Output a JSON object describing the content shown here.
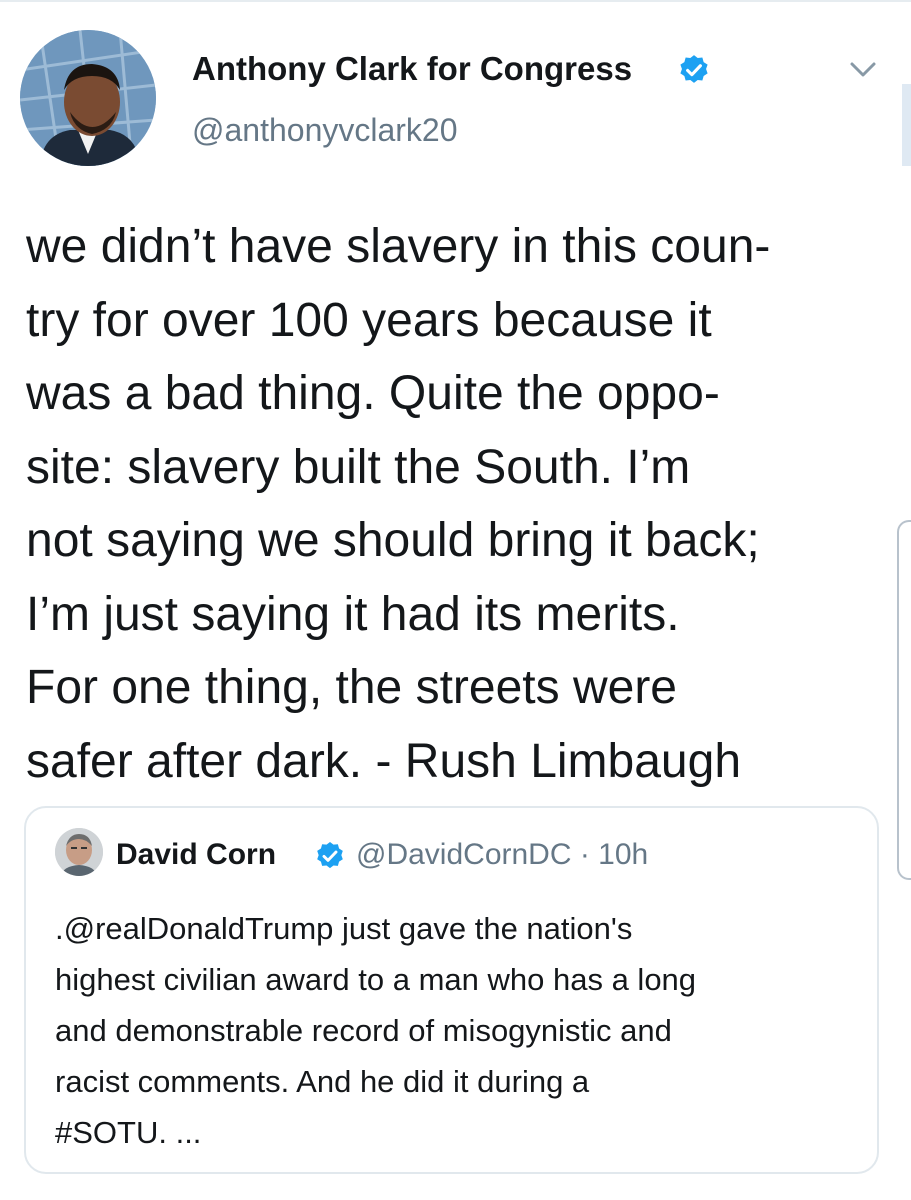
{
  "tweet": {
    "display_name": "Anthony Clark for Congress",
    "handle": "@anthonyvclark20",
    "verified_icon": "verified-badge-icon",
    "caret_icon": "chevron-down-icon",
    "text_lines": [
      "we didn’t have slavery in this coun-",
      "try for over 100 years because it",
      "was a bad thing. Quite the oppo-",
      "site: slavery built the South. I’m",
      "not saying we should bring it back;",
      "I’m just saying it had its merits.",
      "For one thing, the streets were",
      "safer after dark. - Rush Limbaugh"
    ]
  },
  "quoted_tweet": {
    "display_name": "David Corn",
    "handle_time": "@DavidCornDC · 10h",
    "text_lines": [
      ".@realDonaldTrump just gave the nation's",
      "highest civilian award to a man who has a long",
      "and demonstrable record of misogynistic and",
      "racist comments. And he did it during a",
      "#SOTU. ..."
    ]
  },
  "colors": {
    "text": "#14171a",
    "secondary": "#657786",
    "verified": "#1da1f2",
    "border": "#e1e8ed"
  }
}
